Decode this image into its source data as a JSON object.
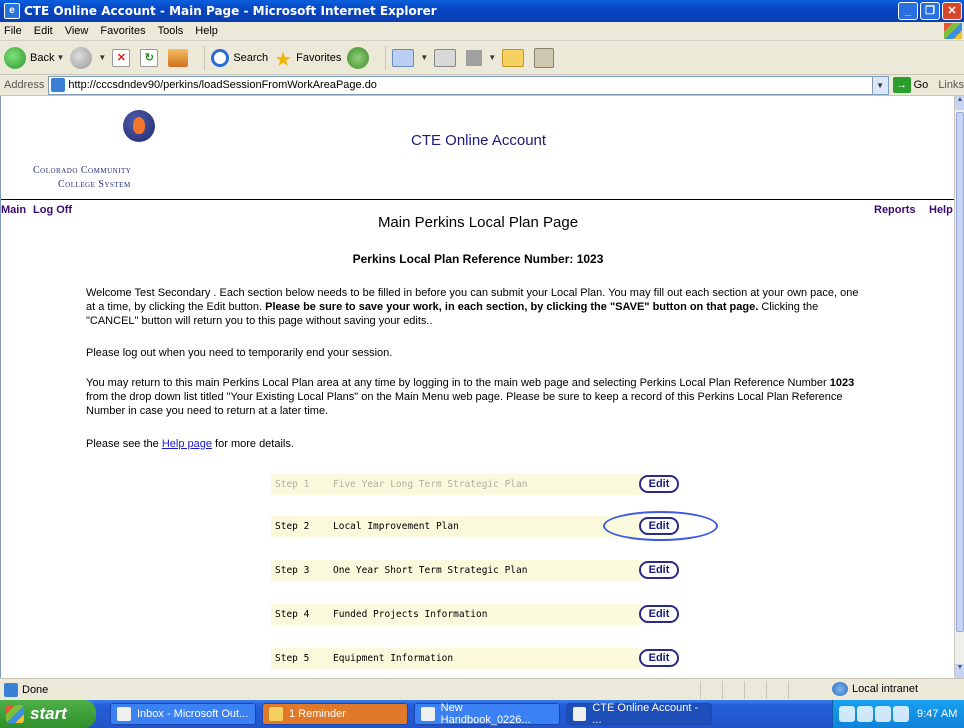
{
  "window": {
    "title": "CTE Online Account - Main Page - Microsoft Internet Explorer"
  },
  "menu": [
    "File",
    "Edit",
    "View",
    "Favorites",
    "Tools",
    "Help"
  ],
  "toolbar": {
    "back": "Back",
    "search": "Search",
    "favorites": "Favorites"
  },
  "address": {
    "label": "Address",
    "url": "http://cccsdndev90/perkins/loadSessionFromWorkAreaPage.do",
    "go": "Go",
    "links": "Links"
  },
  "header": {
    "org_line1": "Colorado Community",
    "org_line2": "College System",
    "site_title": "CTE Online Account"
  },
  "nav": {
    "main": "Main",
    "logoff": "Log Off",
    "reports": "Reports",
    "help": "Help"
  },
  "page": {
    "title": "Main Perkins Local Plan Page",
    "reference": "Perkins Local Plan Reference Number: 1023",
    "p1_a": "Welcome Test Secondary . Each section below needs to be filled in before you can submit your Local Plan. You may fill out each section at your own pace, one at a time, by clicking the Edit button. ",
    "p1_bold": "Please be sure to save your work, in each section, by clicking the \"SAVE\" button on that page.",
    "p1_c": " Clicking the \"CANCEL\" button will return you to this page without saving your edits..",
    "p2": "Please log out when you need to temporarily end your session.",
    "p3_a": "You may return to this main Perkins Local Plan area at any time by logging in to the main web page and selecting Perkins Local Plan Reference Number ",
    "p3_bold": "1023",
    "p3_c": " from the drop down list titled \"Your Existing Local Plans\" on the Main Menu web page. Please be sure to keep a record of this Perkins Local Plan Reference Number in case you need to return at a later time.",
    "p4_a": "Please see the ",
    "p4_link": "Help page",
    "p4_c": " for more details."
  },
  "steps": [
    {
      "num": "Step 1",
      "label": "Five Year Long Term Strategic Plan",
      "edit": "Edit"
    },
    {
      "num": "Step 2",
      "label": "Local Improvement Plan",
      "edit": "Edit"
    },
    {
      "num": "Step 3",
      "label": "One Year Short Term Strategic Plan",
      "edit": "Edit"
    },
    {
      "num": "Step 4",
      "label": "Funded Projects Information",
      "edit": "Edit"
    },
    {
      "num": "Step 5",
      "label": "Equipment Information",
      "edit": "Edit"
    }
  ],
  "status": {
    "text": "Done",
    "zone": "Local intranet"
  },
  "taskbar": {
    "start": "start",
    "tasks": [
      "Inbox - Microsoft Out...",
      "1 Reminder",
      "New Handbook_0226...",
      "CTE Online Account - ..."
    ],
    "time": "9:47 AM"
  }
}
